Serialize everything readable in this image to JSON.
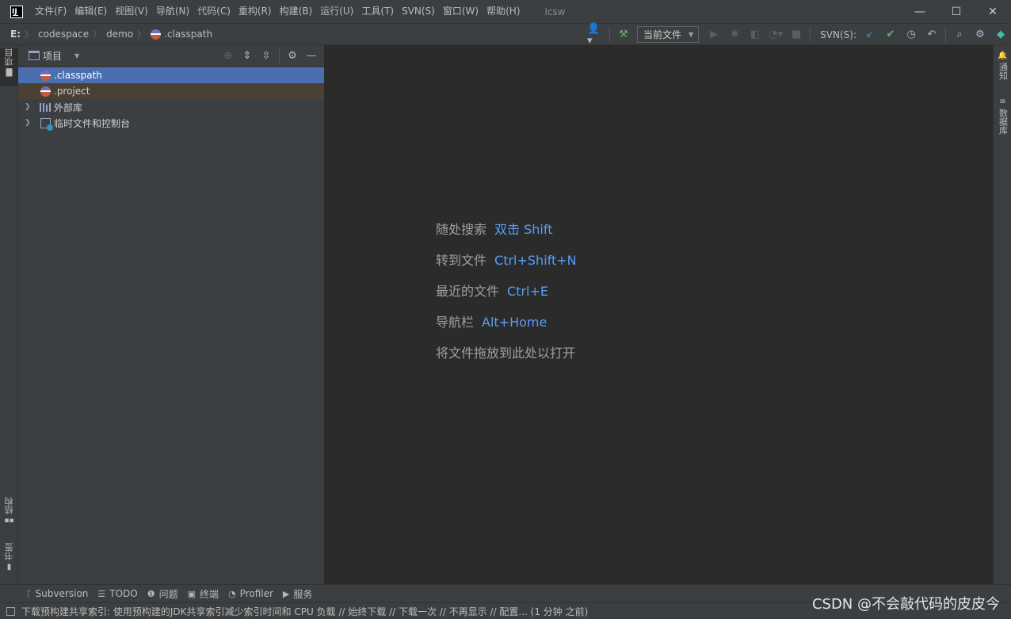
{
  "menu": {
    "items": [
      "文件(F)",
      "编辑(E)",
      "视图(V)",
      "导航(N)",
      "代码(C)",
      "重构(R)",
      "构建(B)",
      "运行(U)",
      "工具(T)",
      "SVN(S)",
      "窗口(W)",
      "帮助(H)"
    ],
    "window_title": "lcsw"
  },
  "window_controls": {
    "minimize": "—",
    "maximize": "☐",
    "close": "✕"
  },
  "breadcrumb": {
    "drive": "E:",
    "items": [
      "codespace",
      "demo",
      ".classpath"
    ]
  },
  "toolbar": {
    "run_config": "当前文件",
    "svn_label": "SVN(S):"
  },
  "left_stripe": {
    "project": "项目",
    "structure": "结构",
    "bookmarks": "书签"
  },
  "right_stripe": {
    "notifications": "通知",
    "database": "数据库"
  },
  "project_panel": {
    "title": "项目",
    "tree": [
      {
        "label": ".classpath",
        "state": "selected"
      },
      {
        "label": ".project",
        "state": "modified"
      },
      {
        "label": "外部库",
        "state": "collapsed"
      },
      {
        "label": "临时文件和控制台",
        "state": "collapsed"
      }
    ]
  },
  "editor_hints": [
    {
      "label": "随处搜索",
      "key": "双击 Shift"
    },
    {
      "label": "转到文件",
      "key": "Ctrl+Shift+N"
    },
    {
      "label": "最近的文件",
      "key": "Ctrl+E"
    },
    {
      "label": "导航栏",
      "key": "Alt+Home"
    },
    {
      "label": "将文件拖放到此处以打开",
      "key": ""
    }
  ],
  "bottom_tabs": [
    "Subversion",
    "TODO",
    "问题",
    "终端",
    "Profiler",
    "服务"
  ],
  "status": {
    "message": "下载预构建共享索引: 使用预构建的JDK共享索引减少索引时间和 CPU 负载 // 始终下载 // 下载一次 // 不再显示 // 配置... (1 分钟 之前)"
  },
  "watermark": "CSDN @不会敲代码的皮皮今",
  "colors": {
    "background": "#2b2b2b",
    "panel": "#3c3f41",
    "selection": "#4b6eaf",
    "link": "#589df6"
  }
}
